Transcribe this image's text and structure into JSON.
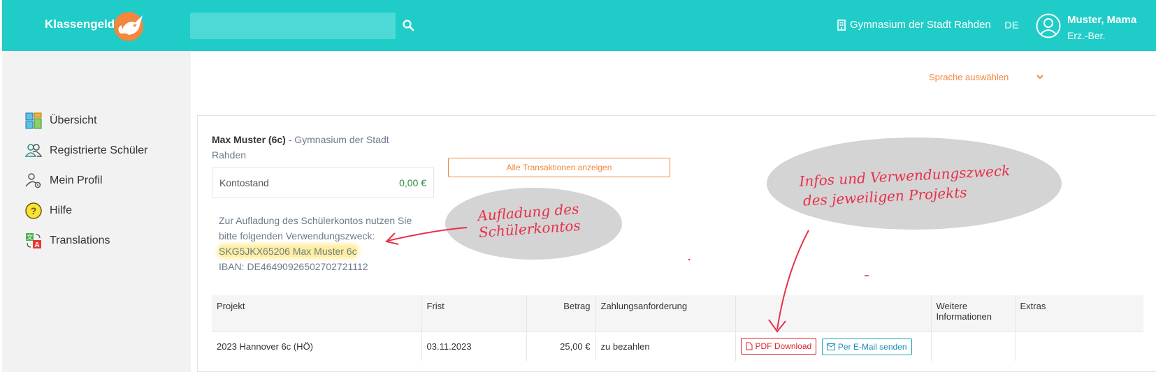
{
  "header": {
    "app_title": "Klassengeld",
    "search_placeholder": "",
    "school_name": "Gymnasium der Stadt Rahden",
    "language": "DE",
    "user_name": "Muster, Mama",
    "user_role": "Erz.-Ber."
  },
  "sidebar": {
    "items": [
      {
        "label": "Übersicht",
        "icon": "dashboard-icon"
      },
      {
        "label": "Registrierte Schüler",
        "icon": "users-icon"
      },
      {
        "label": "Mein Profil",
        "icon": "user-settings-icon"
      },
      {
        "label": "Hilfe",
        "icon": "help-icon"
      },
      {
        "label": "Translations",
        "icon": "translate-icon"
      }
    ]
  },
  "main": {
    "language_select": "Sprache auswählen",
    "student_name": "Max Muster (6c)",
    "student_school": "- Gymnasium der Stadt Rahden",
    "balance_label": "Kontostand",
    "balance_value": "0,00 €",
    "all_transactions_button": "Alle Transaktionen anzeigen",
    "info_line1": "Zur Aufladung des Schülerkontos nutzen Sie",
    "info_line2": "bitte folgenden Verwendungszweck:",
    "reference": "SKG5JKX65206 Max Muster 6c",
    "iban": "IBAN: DE46490926502702721112"
  },
  "table": {
    "headers": [
      "Projekt",
      "Frist",
      "Betrag",
      "Zahlungsanforderung",
      "",
      "Weitere Informationen",
      "Extras"
    ],
    "rows": [
      {
        "projekt": "2023 Hannover 6c (HÖ)",
        "frist": "03.11.2023",
        "betrag": "25,00 €",
        "status": "zu bezahlen",
        "pdf_button": "PDF Download",
        "mail_button": "Per E-Mail senden"
      }
    ]
  },
  "annotations": {
    "note1_line1": "Aufladung des",
    "note1_line2": "Schülerkontos",
    "note2_line1": "Infos und Verwendungszweck",
    "note2_line2": "des jeweiligen Projekts"
  },
  "colors": {
    "header_bg": "#20ccc8",
    "accent_orange": "#f2873d",
    "status_red": "#d9232d",
    "balance_green": "#2e8b3c",
    "annotation_red": "#e8304a"
  }
}
